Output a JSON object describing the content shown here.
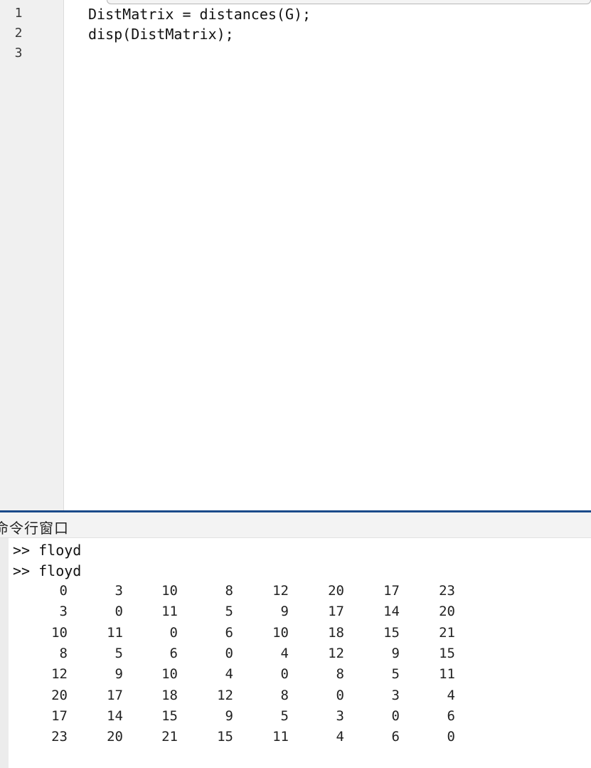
{
  "editor": {
    "line_numbers": [
      "1",
      "2",
      "3"
    ],
    "lines": [
      "DistMatrix = distances(G);",
      "disp(DistMatrix);",
      ""
    ]
  },
  "command_window": {
    "title": "命令行窗口",
    "history": [
      ">> floyd",
      ">> floyd"
    ],
    "matrix": [
      [
        "0",
        "3",
        "10",
        "8",
        "12",
        "20",
        "17",
        "23"
      ],
      [
        "3",
        "0",
        "11",
        "5",
        "9",
        "17",
        "14",
        "20"
      ],
      [
        "10",
        "11",
        "0",
        "6",
        "10",
        "18",
        "15",
        "21"
      ],
      [
        "8",
        "5",
        "6",
        "0",
        "4",
        "12",
        "9",
        "15"
      ],
      [
        "12",
        "9",
        "10",
        "4",
        "0",
        "8",
        "5",
        "11"
      ],
      [
        "20",
        "17",
        "18",
        "12",
        "8",
        "0",
        "3",
        "4"
      ],
      [
        "17",
        "14",
        "15",
        "9",
        "5",
        "3",
        "0",
        "6"
      ],
      [
        "23",
        "20",
        "21",
        "15",
        "11",
        "4",
        "6",
        "0"
      ]
    ]
  },
  "colors": {
    "splitter": "#1a4a8a",
    "gutter": "#f0f0f0"
  }
}
